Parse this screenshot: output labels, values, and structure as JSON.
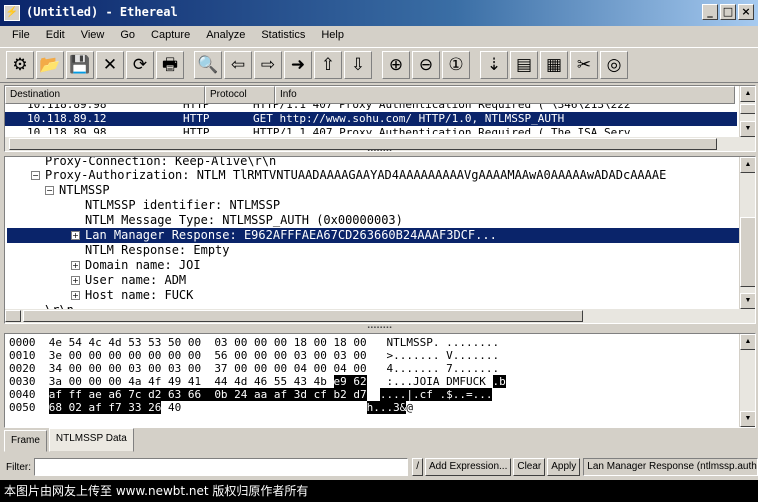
{
  "window": {
    "title": "(Untitled) - Ethereal",
    "buttons": [
      "_",
      "□",
      "×"
    ]
  },
  "menu": [
    "File",
    "Edit",
    "View",
    "Go",
    "Capture",
    "Analyze",
    "Statistics",
    "Help"
  ],
  "toolbar": [
    {
      "name": "capture-options-icon",
      "glyph": "⚙"
    },
    {
      "name": "open-file-icon",
      "glyph": "📂"
    },
    {
      "name": "save-icon",
      "glyph": "💾"
    },
    {
      "name": "close-file-icon",
      "glyph": "✕"
    },
    {
      "name": "reload-icon",
      "glyph": "⟳"
    },
    {
      "name": "print-icon",
      "glyph": "🖶"
    },
    {
      "name": "find-packet-icon",
      "glyph": "🔍"
    },
    {
      "name": "go-back-icon",
      "glyph": "⇦"
    },
    {
      "name": "go-forward-icon",
      "glyph": "⇨"
    },
    {
      "name": "go-to-packet-icon",
      "glyph": "➜"
    },
    {
      "name": "go-first-icon",
      "glyph": "⇧"
    },
    {
      "name": "go-last-icon",
      "glyph": "⇩"
    },
    {
      "name": "zoom-in-icon",
      "glyph": "⊕"
    },
    {
      "name": "zoom-out-icon",
      "glyph": "⊖"
    },
    {
      "name": "zoom-normal-icon",
      "glyph": "①"
    },
    {
      "name": "capture-filters-icon",
      "glyph": "⇣"
    },
    {
      "name": "display-filters-icon",
      "glyph": "▤"
    },
    {
      "name": "coloring-rules-icon",
      "glyph": "▦"
    },
    {
      "name": "preferences-icon",
      "glyph": "✂"
    },
    {
      "name": "help-icon",
      "glyph": "◎"
    }
  ],
  "packet_list": {
    "columns": [
      "Destination",
      "Protocol",
      "Info"
    ],
    "rows": [
      {
        "dest": "10.118.89.98",
        "proto": "HTTP",
        "info": "HTTP/1.1 407 Proxy Authentication Required ( \\346\\213\\222"
      },
      {
        "dest": "10.118.89.12",
        "proto": "HTTP",
        "info": "GET http://www.sohu.com/ HTTP/1.0, NTLMSSP_AUTH"
      },
      {
        "dest": "10.118.89.98",
        "proto": "HTTP",
        "info": "HTTP/1.1 407 Proxy Authentication Required ( The ISA Serv"
      }
    ]
  },
  "detail_tree": {
    "proxy_connection": "Proxy-Connection: Keep-Alive\\r\\n",
    "proxy_auth": "Proxy-Authorization: NTLM TlRMTVNTUAADAAAAGAAYAD4AAAAAAAAAVgAAAAMAAwA0AAAAAwADADcAAAAE",
    "ntlmssp": "NTLMSSP",
    "identifier": "NTLMSSP identifier: NTLMSSP",
    "msg_type": "NTLM Message Type: NTLMSSP_AUTH (0x00000003)",
    "lm_response": "Lan Manager Response: E962AFFFAEA67CD263660B24AAAF3DCF...",
    "ntlm_response": "NTLM Response: Empty",
    "domain": "Domain name: JOI",
    "user": "User name: ADM",
    "host": "Host name: FUCK",
    "trailing": "\\r\\n"
  },
  "hex_dump": [
    {
      "off": "0000",
      "a": "4e 54 4c 4d 53 53 50 00  03 00 00 00 18 00 18 00",
      "hhl": "",
      "hrest": "",
      "ascii": "NTLMSSP. ........",
      "ahl": "",
      "arest": ""
    },
    {
      "off": "0010",
      "a": "3e 00 00 00 00 00 00 00  56 00 00 00 03 00 03 00",
      "hhl": "",
      "hrest": "",
      "ascii": ">....... V.......",
      "ahl": "",
      "arest": ""
    },
    {
      "off": "0020",
      "a": "34 00 00 00 03 00 03 00  37 00 00 00 04 00 04 00",
      "hhl": "",
      "hrest": "",
      "ascii": "4....... 7.......",
      "ahl": "",
      "arest": ""
    },
    {
      "off": "0030",
      "a": "3a 00 00 00 4a 4f 49 41  44 4d 46 55 43 4b ",
      "hhl": "e9 62",
      "hrest": "",
      "ascii": ":...JOIA DMFUCK",
      "ahl": ".b",
      "arest": ""
    },
    {
      "off": "0040",
      "a": "",
      "hhl": "af ff ae a6 7c d2 63 66  0b 24 aa af 3d cf b2 d7",
      "hrest": "",
      "ascii": "",
      "ahl": "....|.cf .$..=...",
      "arest": ""
    },
    {
      "off": "0050",
      "a": "",
      "hhl": "68 02 af f7 33 26",
      "hrest": " 40",
      "ascii": "",
      "ahl": "h...3&",
      "arest": "@"
    }
  ],
  "tabs": [
    "Frame",
    "NTLMSSP Data"
  ],
  "filter": {
    "label": "Filter:",
    "value": "",
    "clear_icon": "/",
    "add_expression": "Add Expression...",
    "clear": "Clear",
    "apply": "Apply",
    "status": "Lan Manager Response (ntlmssp.auth.lmr"
  },
  "watermark": "本图片由网友上传至 www.newbt.net 版权归原作者所有"
}
